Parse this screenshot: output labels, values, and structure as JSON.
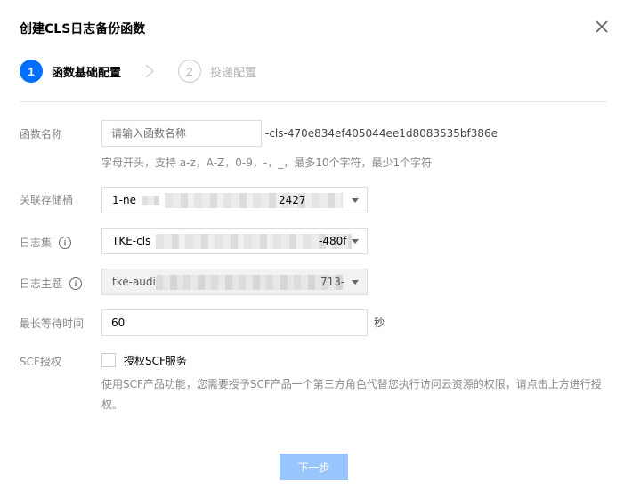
{
  "dialog": {
    "title": "创建CLS日志备份函数",
    "close_icon": "close-icon"
  },
  "steps": [
    {
      "number": "1",
      "label": "函数基础配置",
      "state": "active"
    },
    {
      "number": "2",
      "label": "投递配置",
      "state": "inactive"
    }
  ],
  "form": {
    "function_name": {
      "label": "函数名称",
      "placeholder": "请输入函数名称",
      "value": "",
      "suffix": "-cls-470e834ef405044ee1d8083535bf386e",
      "hint": "字母开头，支持 a-z，A-Z，0-9，-，_，最多10个字符，最少1个字符"
    },
    "bucket": {
      "label": "关联存储桶",
      "value_prefix": "1-ne",
      "value_suffix": "2427"
    },
    "logset": {
      "label": "日志集",
      "info_icon": "info-icon",
      "value_prefix": "TKE-cls",
      "value_suffix": "-480f"
    },
    "topic": {
      "label": "日志主题",
      "info_icon": "info-icon",
      "value_prefix": "tke-audi",
      "value_suffix": "713-",
      "disabled": true
    },
    "max_wait": {
      "label": "最长等待时间",
      "value": "60",
      "unit": "秒"
    },
    "scf_auth": {
      "label": "SCF授权",
      "checkbox_label": "授权SCF服务",
      "checked": false,
      "hint_line1": "使用SCF产品功能，您需要授予SCF产品一个第三方角色代替您执行访问云资源的权限，请点击上方进行授",
      "hint_line2": "权。"
    }
  },
  "footer": {
    "next_label": "下一步",
    "next_enabled": false
  },
  "colors": {
    "primary": "#006eff",
    "disabled_button": "#99c5ff",
    "divider": "#e5e5e5"
  }
}
